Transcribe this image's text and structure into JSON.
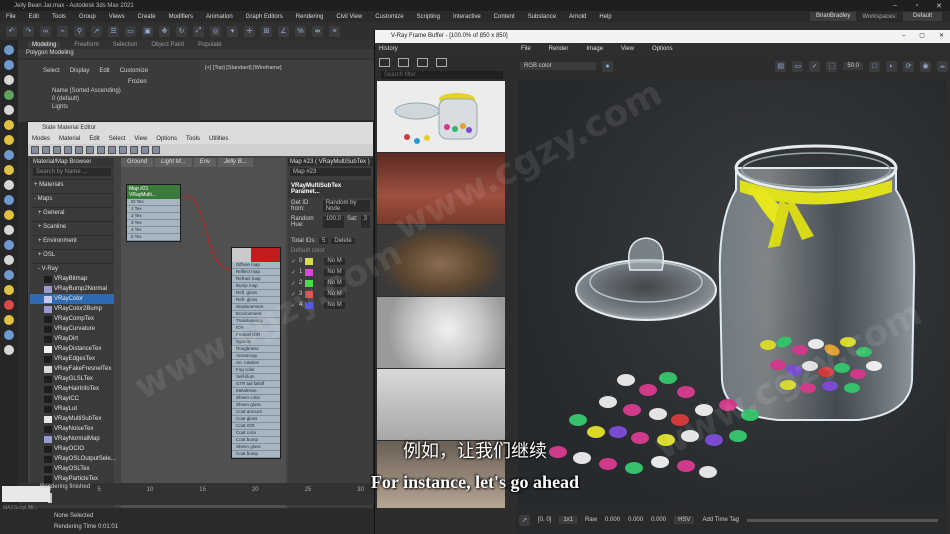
{
  "window": {
    "title": "Jelly Bean Jar.max - Autodesk 3ds Max 2021"
  },
  "menubar": {
    "items": [
      "File",
      "Edit",
      "Tools",
      "Group",
      "Views",
      "Create",
      "Modifiers",
      "Animation",
      "Graph Editors",
      "Rendering",
      "Civil View",
      "Customize",
      "Scripting",
      "Interactive",
      "Content",
      "Substance",
      "Arnold",
      "Help"
    ],
    "user": "BrianBradley",
    "workspaces_label": "Workspaces:",
    "workspace": "Default"
  },
  "ribbon": {
    "tabs": [
      "Modeling",
      "Freeform",
      "Selection",
      "Object Paint",
      "Populate"
    ],
    "sub": "Polygon Modeling"
  },
  "scene_explorer": {
    "tabs": [
      "Select",
      "Display",
      "Edit",
      "Customize"
    ],
    "frozen": "Frozen",
    "rows": [
      "Name (Sorted Ascending)",
      "0 (default)",
      "Lights"
    ]
  },
  "viewport": {
    "label": "[+] [Top] [Standard] [Wireframe]"
  },
  "slate": {
    "title": "Slate Material Editor",
    "menus": [
      "Modes",
      "Material",
      "Edit",
      "Select",
      "View",
      "Options",
      "Tools",
      "Utilities"
    ],
    "view_tabs": [
      "Ground",
      "Light M...",
      "Env",
      "Jelly B..."
    ],
    "browser": {
      "title": "Material/Map Browser",
      "search": "Search by Name ...",
      "categories": [
        "+ Materials",
        "- Maps",
        "+ General",
        "+ Scanline",
        "+ Environment",
        "+ OSL",
        "- V-Ray"
      ],
      "maps": [
        {
          "name": "VRayBitmap",
          "sw": "#1d1d1d"
        },
        {
          "name": "VRayBump2Normal",
          "sw": "#9a9ad0"
        },
        {
          "name": "VRayColor",
          "sw": "#c9c9ee",
          "selected": true
        },
        {
          "name": "VRayColor2Bump",
          "sw": "#9a9ad0"
        },
        {
          "name": "VRayCompTex",
          "sw": "#1d1d1d"
        },
        {
          "name": "VRayCurvature",
          "sw": "#1d1d1d"
        },
        {
          "name": "VRayDirt",
          "sw": "#1d1d1d"
        },
        {
          "name": "VRayDistanceTex",
          "sw": "#f2f2f2"
        },
        {
          "name": "VRayEdgesTex",
          "sw": "#1d1d1d"
        },
        {
          "name": "VRayFakeFresnelTex",
          "sw": "#d8d8d8"
        },
        {
          "name": "VRayGLSLTex",
          "sw": "#1d1d1d"
        },
        {
          "name": "VRayHairInfoTex",
          "sw": "#1d1d1d"
        },
        {
          "name": "VRayICC",
          "sw": "#1d1d1d"
        },
        {
          "name": "VRayLut",
          "sw": "#1d1d1d"
        },
        {
          "name": "VRayMultiSubTex",
          "sw": "#e6e6e6"
        },
        {
          "name": "VRayNoiseTex",
          "sw": "#1d1d1d"
        },
        {
          "name": "VRayNormalMap",
          "sw": "#9a9ad0"
        },
        {
          "name": "VRayOCIO",
          "sw": "#1d1d1d"
        },
        {
          "name": "VRayOSLOutputSele...",
          "sw": "#1d1d1d"
        },
        {
          "name": "VRayOSLTex",
          "sw": "#1d1d1d"
        },
        {
          "name": "VRayParticleTex",
          "sw": "#1d1d1d"
        }
      ]
    },
    "node_map": {
      "title": "Map #21",
      "subtitle": "VRayMulti...",
      "slots": [
        "ID Tex",
        "1 Tex",
        "2 Tex",
        "3 Tex",
        "4 Tex",
        "5 Tex"
      ]
    },
    "node_mtl": {
      "slots": [
        "Diffuse map",
        "Reflect map",
        "Refract map",
        "Bump map",
        "Refl. gloss",
        "Refr. gloss",
        "Displacement",
        "Environment",
        "Translucency",
        "IOR",
        "Fresnel IOR",
        "Opacity",
        "Roughness",
        "Anisotropy",
        "An. rotation",
        "Fog color",
        "Self-illum",
        "GTR tail falloff",
        "Metalness",
        "Sheen color",
        "Sheen gloss",
        "Coat amount",
        "Coat gloss",
        "Coat IOR",
        "Coat color",
        "Coat bump",
        "Sheen gloss",
        "Coat bump"
      ]
    },
    "params": {
      "title": "Map #23 ( VRayMultiSubTex )",
      "map_name": "Map #23",
      "section": "VRayMultiSubTex Paramet...",
      "get_id_from_label": "Get ID from:",
      "get_id_from": "Random by Node",
      "random_hue_label": "Random Hue:",
      "random_hue": "100.0",
      "sat_label": "Sat:",
      "sat": "3",
      "total_ids_label": "Total IDs:",
      "total_ids": "5",
      "delete_label": "Delete",
      "default_color_label": "Default color",
      "rows": [
        {
          "id": "0",
          "color": "#d9d949"
        },
        {
          "id": "1",
          "color": "#d94ad9"
        },
        {
          "id": "2",
          "color": "#4ad94a"
        },
        {
          "id": "3",
          "color": "#d94a4a"
        },
        {
          "id": "4",
          "color": "#4a4ad9"
        }
      ],
      "no_map_label": "No M"
    }
  },
  "timeline": {
    "ticks": [
      "0",
      "5",
      "10",
      "15",
      "20",
      "25",
      "30"
    ]
  },
  "status": {
    "script_label": "MAXScript Mi...",
    "rendering_finished": "Rendering finished",
    "none_selected": "None Selected",
    "rendering_time": "Rendering Time 0:01:01"
  },
  "vfb": {
    "title": "V-Ray Frame Buffer - [100.0% of 850 x 850]",
    "menus": [
      "File",
      "Render",
      "Image",
      "View",
      "Options"
    ],
    "history_label": "History",
    "search": "Search filter",
    "rgb": "RGB color",
    "zoom": "50.0",
    "coords": "[0, 0]",
    "ratio": "1x1",
    "raw_label": "Raw",
    "vals": [
      "0.000",
      "0.000",
      "0.000"
    ],
    "hsv": "HSV",
    "add_time_tag": "Add Time Tag"
  },
  "subtitles": {
    "cn": "例如，让我们继续",
    "en": "For instance, let's go ahead"
  },
  "watermark": "www.cgzy.com"
}
